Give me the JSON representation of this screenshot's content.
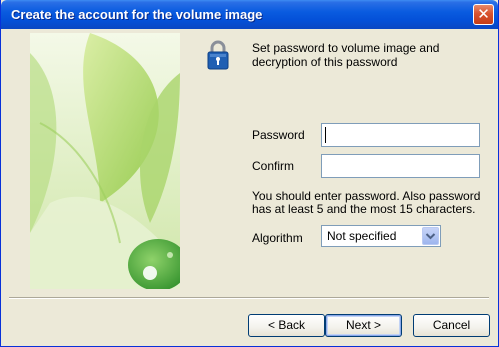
{
  "window": {
    "title": "Create the account for the volume image",
    "close_glyph": "✕"
  },
  "info": {
    "icon": "lock-icon",
    "text": "Set password to volume image and decryption of this password"
  },
  "form": {
    "password_label": "Password",
    "password_value": "",
    "confirm_label": "Confirm",
    "confirm_value": "",
    "note": "You should enter password. Also password has at least 5 and the most 15 characters.",
    "algorithm_label": "Algorithm",
    "algorithm_value": "Not specified"
  },
  "buttons": {
    "back": "< Back",
    "next": "Next >",
    "cancel": "Cancel"
  },
  "colors": {
    "titlebar": "#0a5ce0",
    "face": "#ece9d8",
    "close": "#d8532f"
  }
}
